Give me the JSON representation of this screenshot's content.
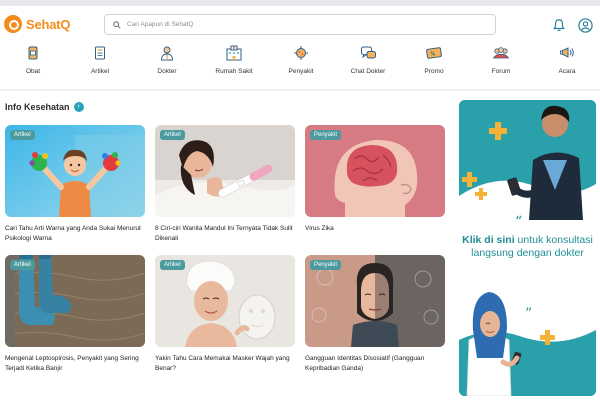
{
  "brand": {
    "name": "SehatQ",
    "color": "#f28c1c"
  },
  "search": {
    "placeholder": "Cari Apapun di SehatQ"
  },
  "header_icons": {
    "notification": "bell-icon",
    "profile": "user-icon"
  },
  "nav": {
    "items": [
      {
        "label": "Obat",
        "icon": "medicine-icon"
      },
      {
        "label": "Artikel",
        "icon": "article-icon"
      },
      {
        "label": "Dokter",
        "icon": "doctor-icon"
      },
      {
        "label": "Rumah Sakit",
        "icon": "hospital-icon"
      },
      {
        "label": "Penyakit",
        "icon": "virus-icon"
      },
      {
        "label": "Chat Dokter",
        "icon": "chat-icon"
      },
      {
        "label": "Promo",
        "icon": "promo-icon"
      },
      {
        "label": "Forum",
        "icon": "forum-icon"
      },
      {
        "label": "Acara",
        "icon": "megaphone-icon"
      }
    ]
  },
  "section": {
    "title": "Info Kesehatan"
  },
  "accent_color": "#2aa3b8",
  "cards": [
    {
      "badge": "Artikel",
      "title": "Cari Tahu Arti Warna yang Anda Sukai Menurut Psikologi Warna"
    },
    {
      "badge": "Artikel",
      "title": "8 Ciri-ciri Wanita Mandul Ini Ternyata Tidak Sulit Dikenali"
    },
    {
      "badge": "Penyakit",
      "title": "Virus Zika"
    },
    {
      "badge": "Artikel",
      "title": "Mengenal Leptospirosis, Penyakit yang Sering Terjadi Ketika Banjir"
    },
    {
      "badge": "Artikel",
      "title": "Yakin Tahu Cara Memakai Masker Wajah yang Benar?"
    },
    {
      "badge": "Penyakit",
      "title": "Gangguan Identitas Disosiatif (Gangguan Kepribadian Ganda)"
    }
  ],
  "banner": {
    "bold": "Klik di sini",
    "rest": " untuk konsultasi langsung dengan dokter"
  }
}
